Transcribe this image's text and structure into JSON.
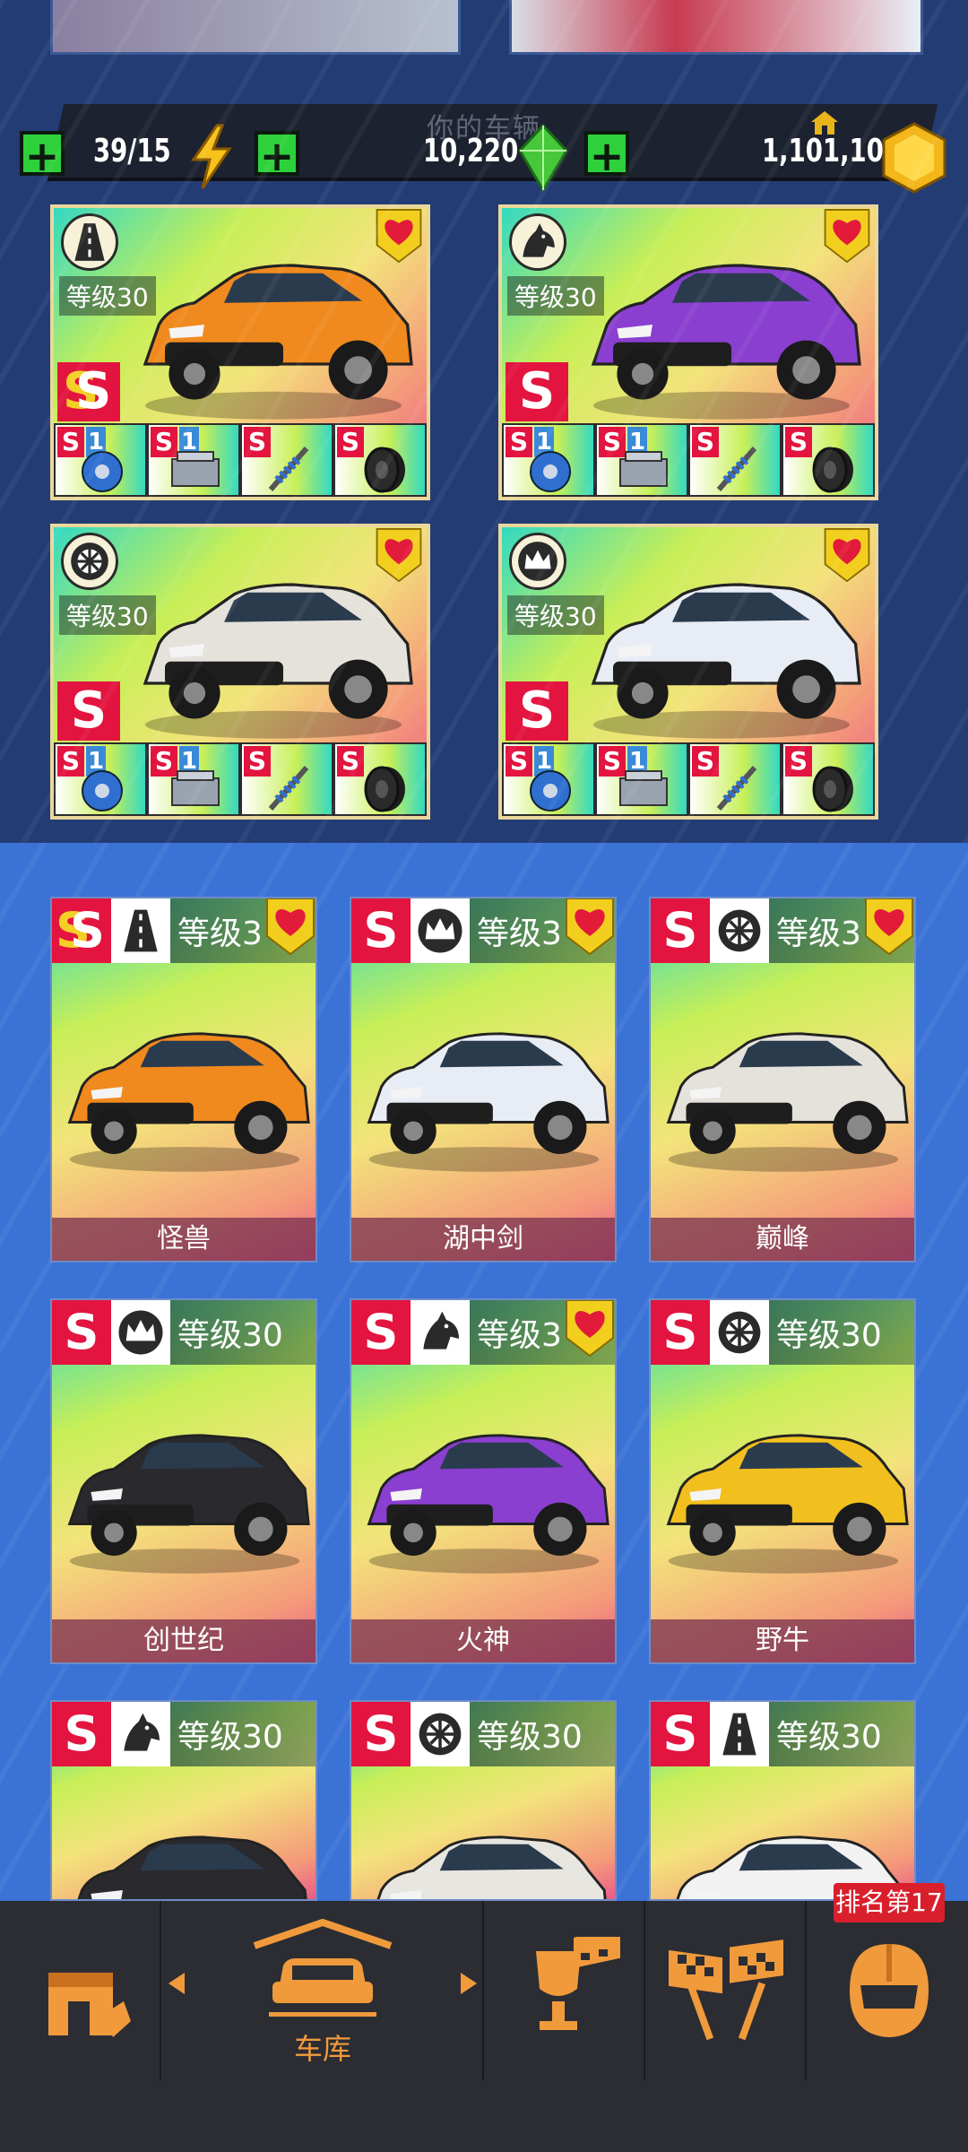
{
  "header": {
    "garage_title": "你的车辆",
    "energy": "39/15",
    "gems": "10,220",
    "coins": "1,101,107"
  },
  "featured": [
    {
      "level": "等级30",
      "rank": "SS",
      "icon": "road-icon",
      "favorite": true,
      "parts": [
        {
          "rank": "S",
          "num": "1",
          "type": "brake"
        },
        {
          "rank": "S",
          "num": "1",
          "type": "engine"
        },
        {
          "rank": "S",
          "type": "suspension"
        },
        {
          "rank": "S",
          "type": "tire"
        }
      ]
    },
    {
      "level": "等级30",
      "rank": "S",
      "icon": "horse-icon",
      "favorite": true,
      "parts": [
        {
          "rank": "S",
          "num": "1",
          "type": "brake"
        },
        {
          "rank": "S",
          "num": "1",
          "type": "engine"
        },
        {
          "rank": "S",
          "type": "suspension"
        },
        {
          "rank": "S",
          "type": "tire"
        }
      ]
    },
    {
      "level": "等级30",
      "rank": "S",
      "icon": "wheel-icon",
      "favorite": true,
      "parts": [
        {
          "rank": "S",
          "num": "1",
          "type": "brake"
        },
        {
          "rank": "S",
          "num": "1",
          "type": "engine"
        },
        {
          "rank": "S",
          "type": "suspension"
        },
        {
          "rank": "S",
          "type": "tire"
        }
      ]
    },
    {
      "level": "等级30",
      "rank": "S",
      "icon": "crown-icon",
      "favorite": true,
      "parts": [
        {
          "rank": "S",
          "num": "1",
          "type": "brake"
        },
        {
          "rank": "S",
          "num": "1",
          "type": "engine"
        },
        {
          "rank": "S",
          "type": "suspension"
        },
        {
          "rank": "S",
          "type": "tire"
        }
      ]
    }
  ],
  "cars": [
    {
      "name": "怪兽",
      "rank": "SS",
      "icon": "road-icon",
      "level": "等级3",
      "favorite": true,
      "color": "#f08a1e"
    },
    {
      "name": "湖中剑",
      "rank": "S",
      "icon": "crown-icon",
      "level": "等级3",
      "favorite": true,
      "color": "#e8edf5"
    },
    {
      "name": "巅峰",
      "rank": "S",
      "icon": "wheel-icon",
      "level": "等级3",
      "favorite": true,
      "color": "#e4e2da"
    },
    {
      "name": "创世纪",
      "rank": "S",
      "icon": "crown-icon",
      "level": "等级30",
      "favorite": false,
      "color": "#2a2a2e"
    },
    {
      "name": "火神",
      "rank": "S",
      "icon": "horse-icon",
      "level": "等级3",
      "favorite": true,
      "color": "#8a3fd0"
    },
    {
      "name": "野牛",
      "rank": "S",
      "icon": "wheel-icon",
      "level": "等级30",
      "favorite": false,
      "color": "#f2c01e"
    },
    {
      "name": "",
      "rank": "S",
      "icon": "horse-icon",
      "level": "等级30",
      "favorite": false,
      "color": "#2a2a2e"
    },
    {
      "name": "",
      "rank": "S",
      "icon": "wheel-icon",
      "level": "等级30",
      "favorite": false,
      "color": "#e8e6e0"
    },
    {
      "name": "",
      "rank": "S",
      "icon": "road-icon",
      "level": "等级30",
      "favorite": false,
      "color": "#f2f2f2"
    }
  ],
  "nav": {
    "garage_label": "车库",
    "rank_badge": "排名第17"
  }
}
